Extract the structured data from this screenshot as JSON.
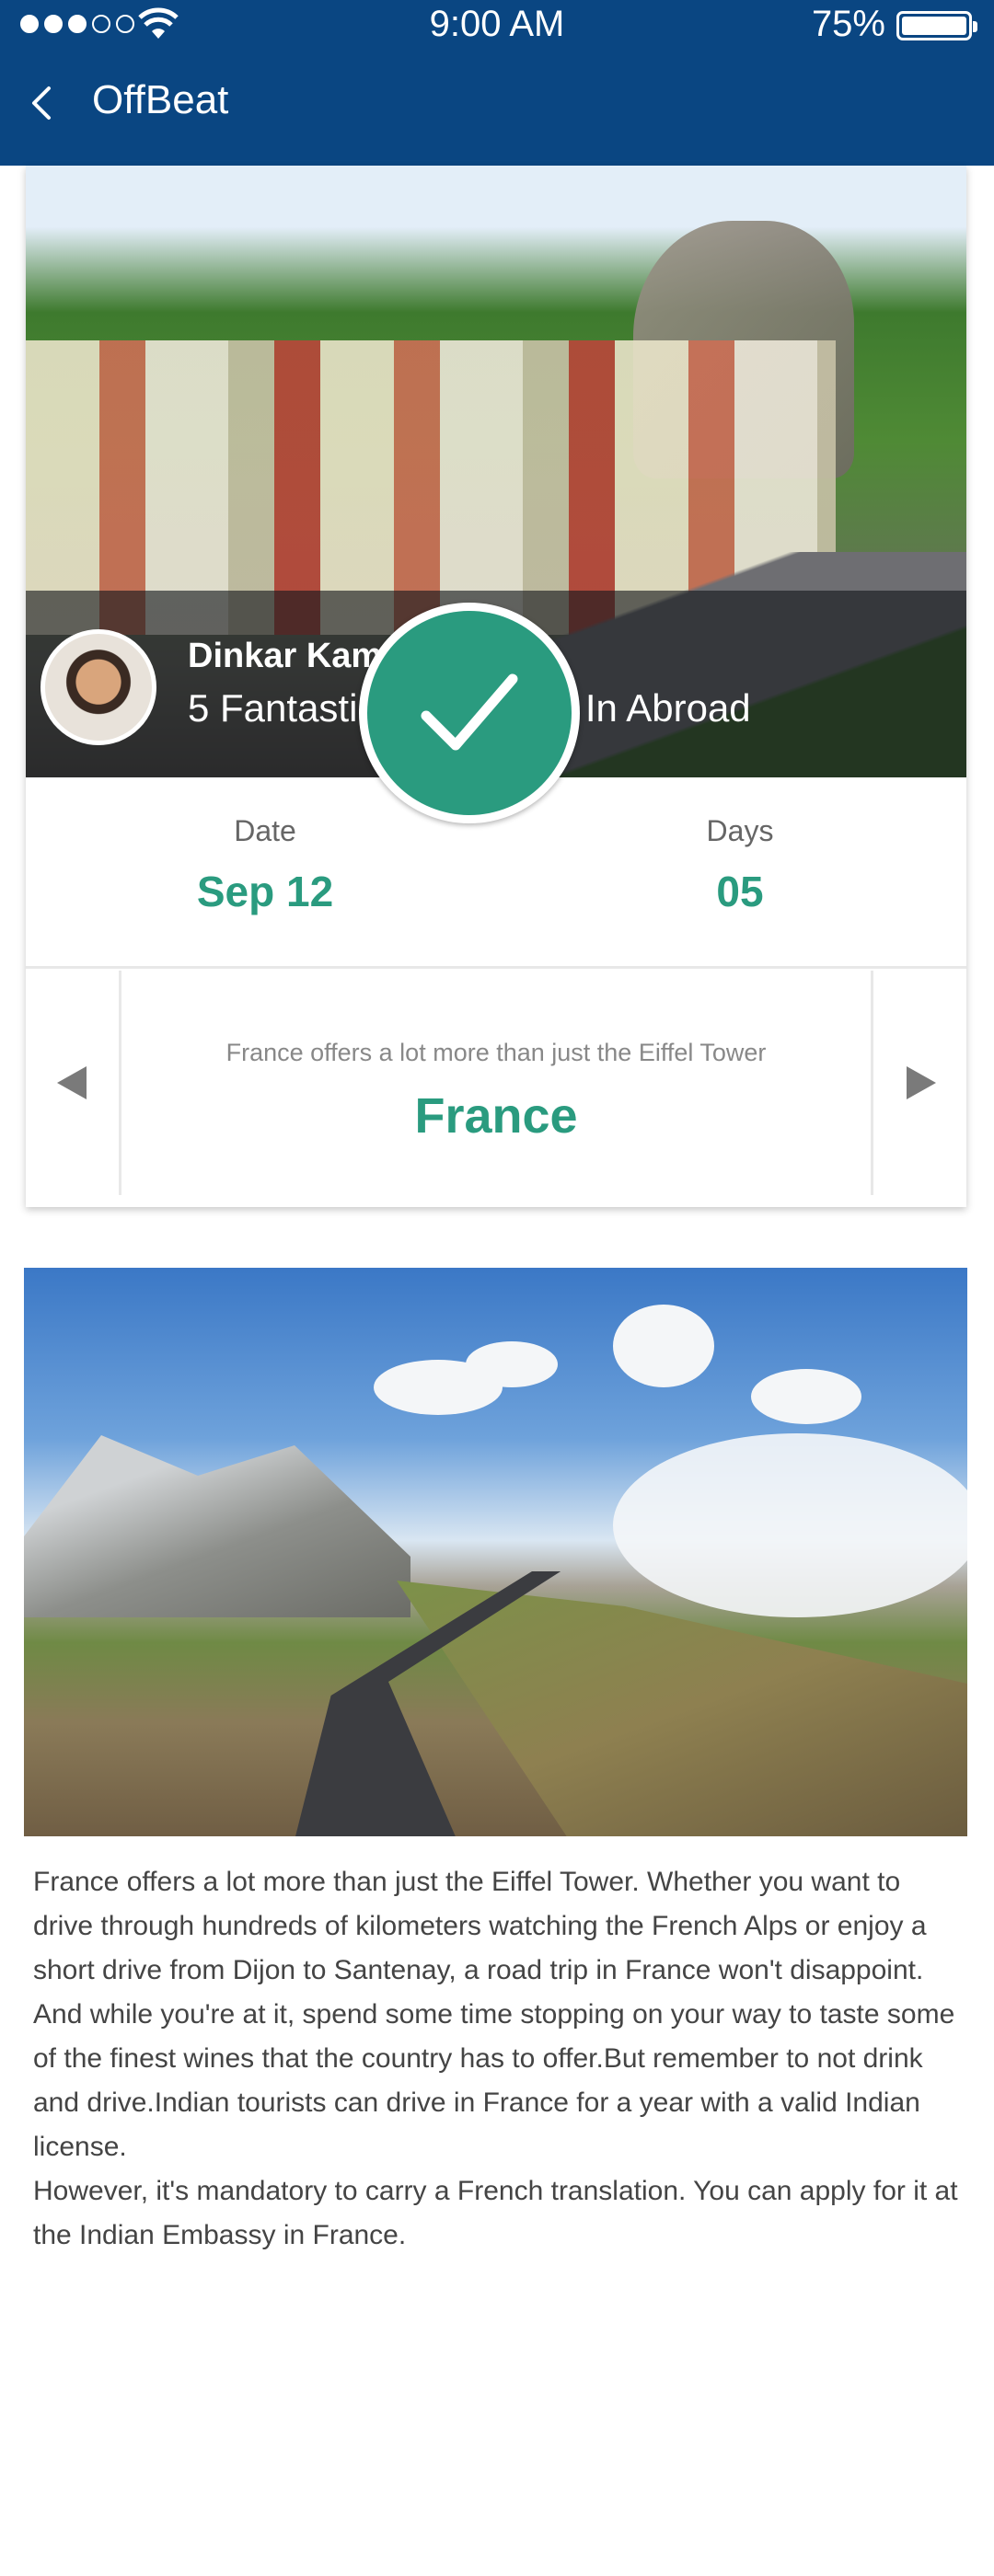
{
  "status_bar": {
    "time": "9:00 AM",
    "battery": "75%",
    "signal_bars_filled": 3,
    "signal_bars_total": 5
  },
  "navbar": {
    "title": "OffBeat",
    "back_icon": "chevron-left-icon"
  },
  "post": {
    "author": "Dinkar Kamat",
    "title": "5 Fantastic Road Trips In Abroad",
    "date_label": "Date",
    "date_value": "Sep 12",
    "days_label": "Days",
    "days_value": "05"
  },
  "country_card": {
    "subtitle": "France offers a lot more than just the Eiffel Tower",
    "name": "France"
  },
  "article": {
    "paragraphs": [
      "France offers a lot more than just the Eiffel Tower. Whether you want to drive through hundreds of kilometers watching the French Alps or enjoy a short drive from Dijon to Santenay, a road trip in France won't disappoint.",
      "And while you're at it, spend some time stopping on your way to taste some of the finest wines that the country has to offer.But remember to not drink and drive.Indian tourists can drive in France for a year with a valid Indian license.",
      "However, it's mandatory to carry a French translation. You can apply for it at the Indian Embassy in France."
    ]
  },
  "colors": {
    "header": "#0a4682",
    "accent": "#2a9b7f"
  }
}
